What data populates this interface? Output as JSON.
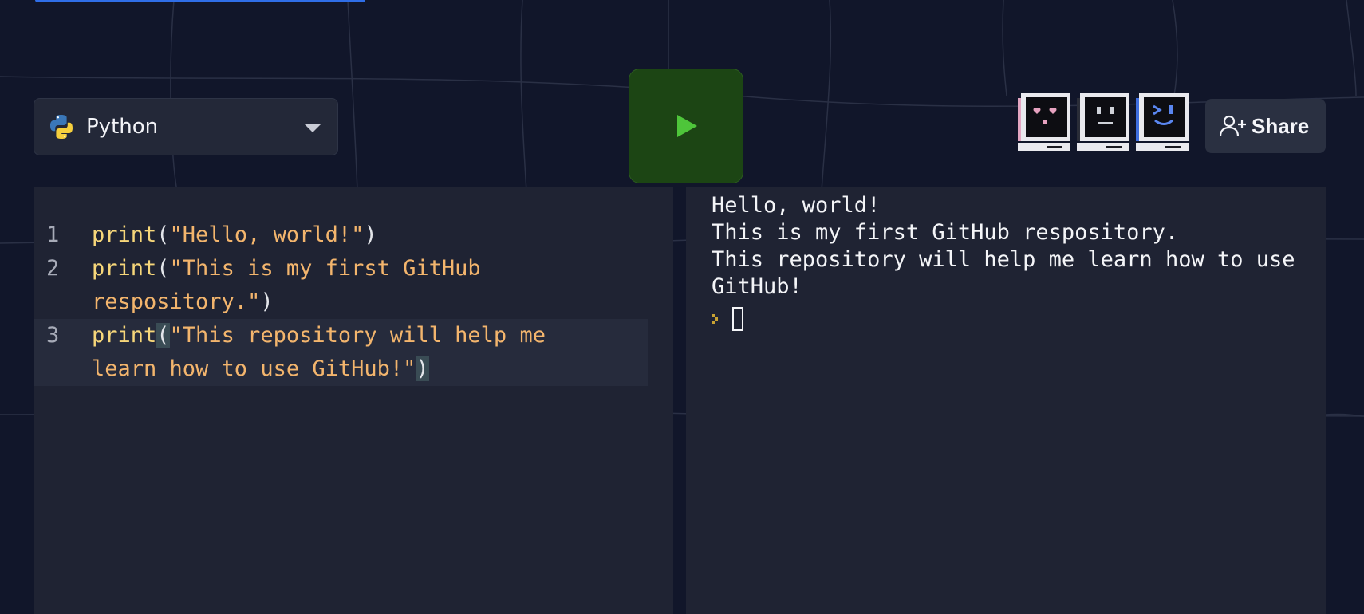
{
  "language_selector": {
    "label": "Python",
    "icon": "python-logo-icon"
  },
  "run_button": {
    "icon": "play-icon",
    "color": "#1c4514"
  },
  "avatars": [
    {
      "icon": "heart-eyes-computer-icon",
      "accent": "#e3a6c2"
    },
    {
      "icon": "neutral-face-computer-icon",
      "accent": "#cfd2d9"
    },
    {
      "icon": "wink-face-computer-icon",
      "accent": "#3f6fe0"
    }
  ],
  "share_button": {
    "label": "Share",
    "icon": "add-person-icon"
  },
  "editor": {
    "lines": [
      {
        "number": "1",
        "fn": "print",
        "open": "(",
        "string": "\"Hello, world!\"",
        "close": ")"
      },
      {
        "number": "2",
        "fn": "print",
        "open": "(",
        "string_part1": "\"This is my first GitHub",
        "string_part2": "respository.\"",
        "close": ")"
      },
      {
        "number": "3",
        "fn": "print",
        "open": "(",
        "string_part1": "\"This repository will help me",
        "string_part2": "learn how to use GitHub!\"",
        "close": ")"
      }
    ]
  },
  "terminal": {
    "output": [
      "Hello, world!",
      "This is my first GitHub respository.",
      "This repository will help me learn how to use",
      "GitHub!"
    ],
    "prompt_icon": "prompt-caret-icon"
  }
}
